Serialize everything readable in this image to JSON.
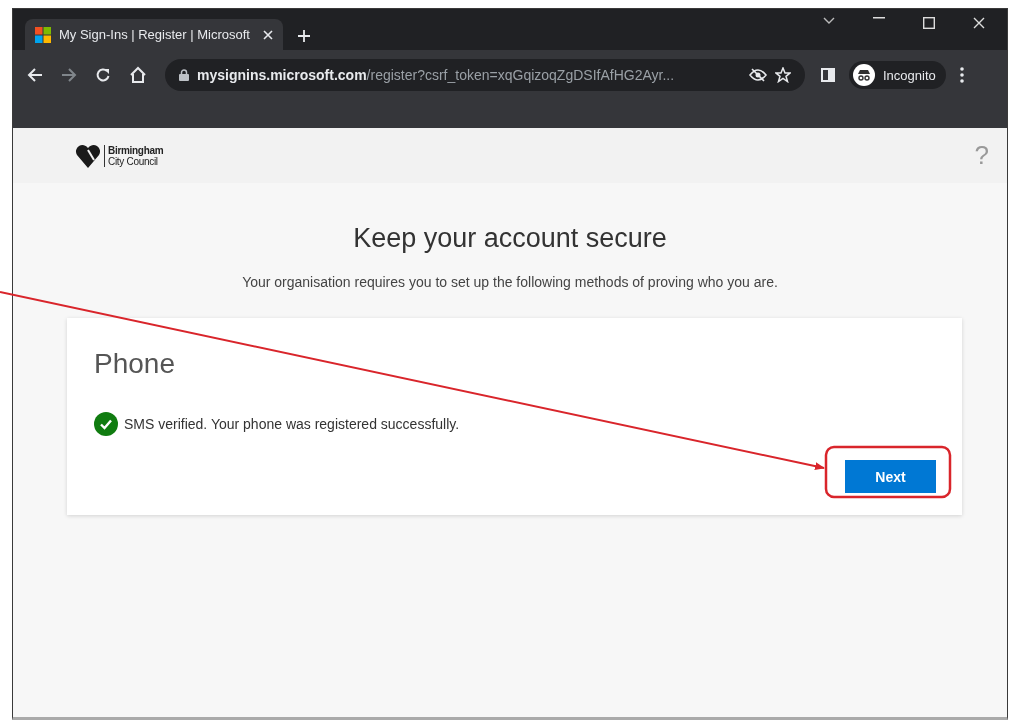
{
  "browser": {
    "tab": {
      "title": "My Sign-Ins | Register | Microsoft",
      "selected": true
    },
    "address": {
      "host": "mysignins.microsoft.com",
      "path": "/register?csrf_token=xqGqizoqZgDSIfAfHG2Ayr..."
    },
    "profile": "Incognito"
  },
  "header": {
    "logo_lines": [
      "Birmingham",
      "City Council"
    ],
    "help": "?"
  },
  "page": {
    "title": "Keep your account secure",
    "subtitle": "Your organisation requires you to set up the following methods of proving who you are."
  },
  "card": {
    "heading": "Phone",
    "status": {
      "kind": "success",
      "text": "SMS verified. Your phone was registered successfully."
    },
    "button": "Next"
  }
}
